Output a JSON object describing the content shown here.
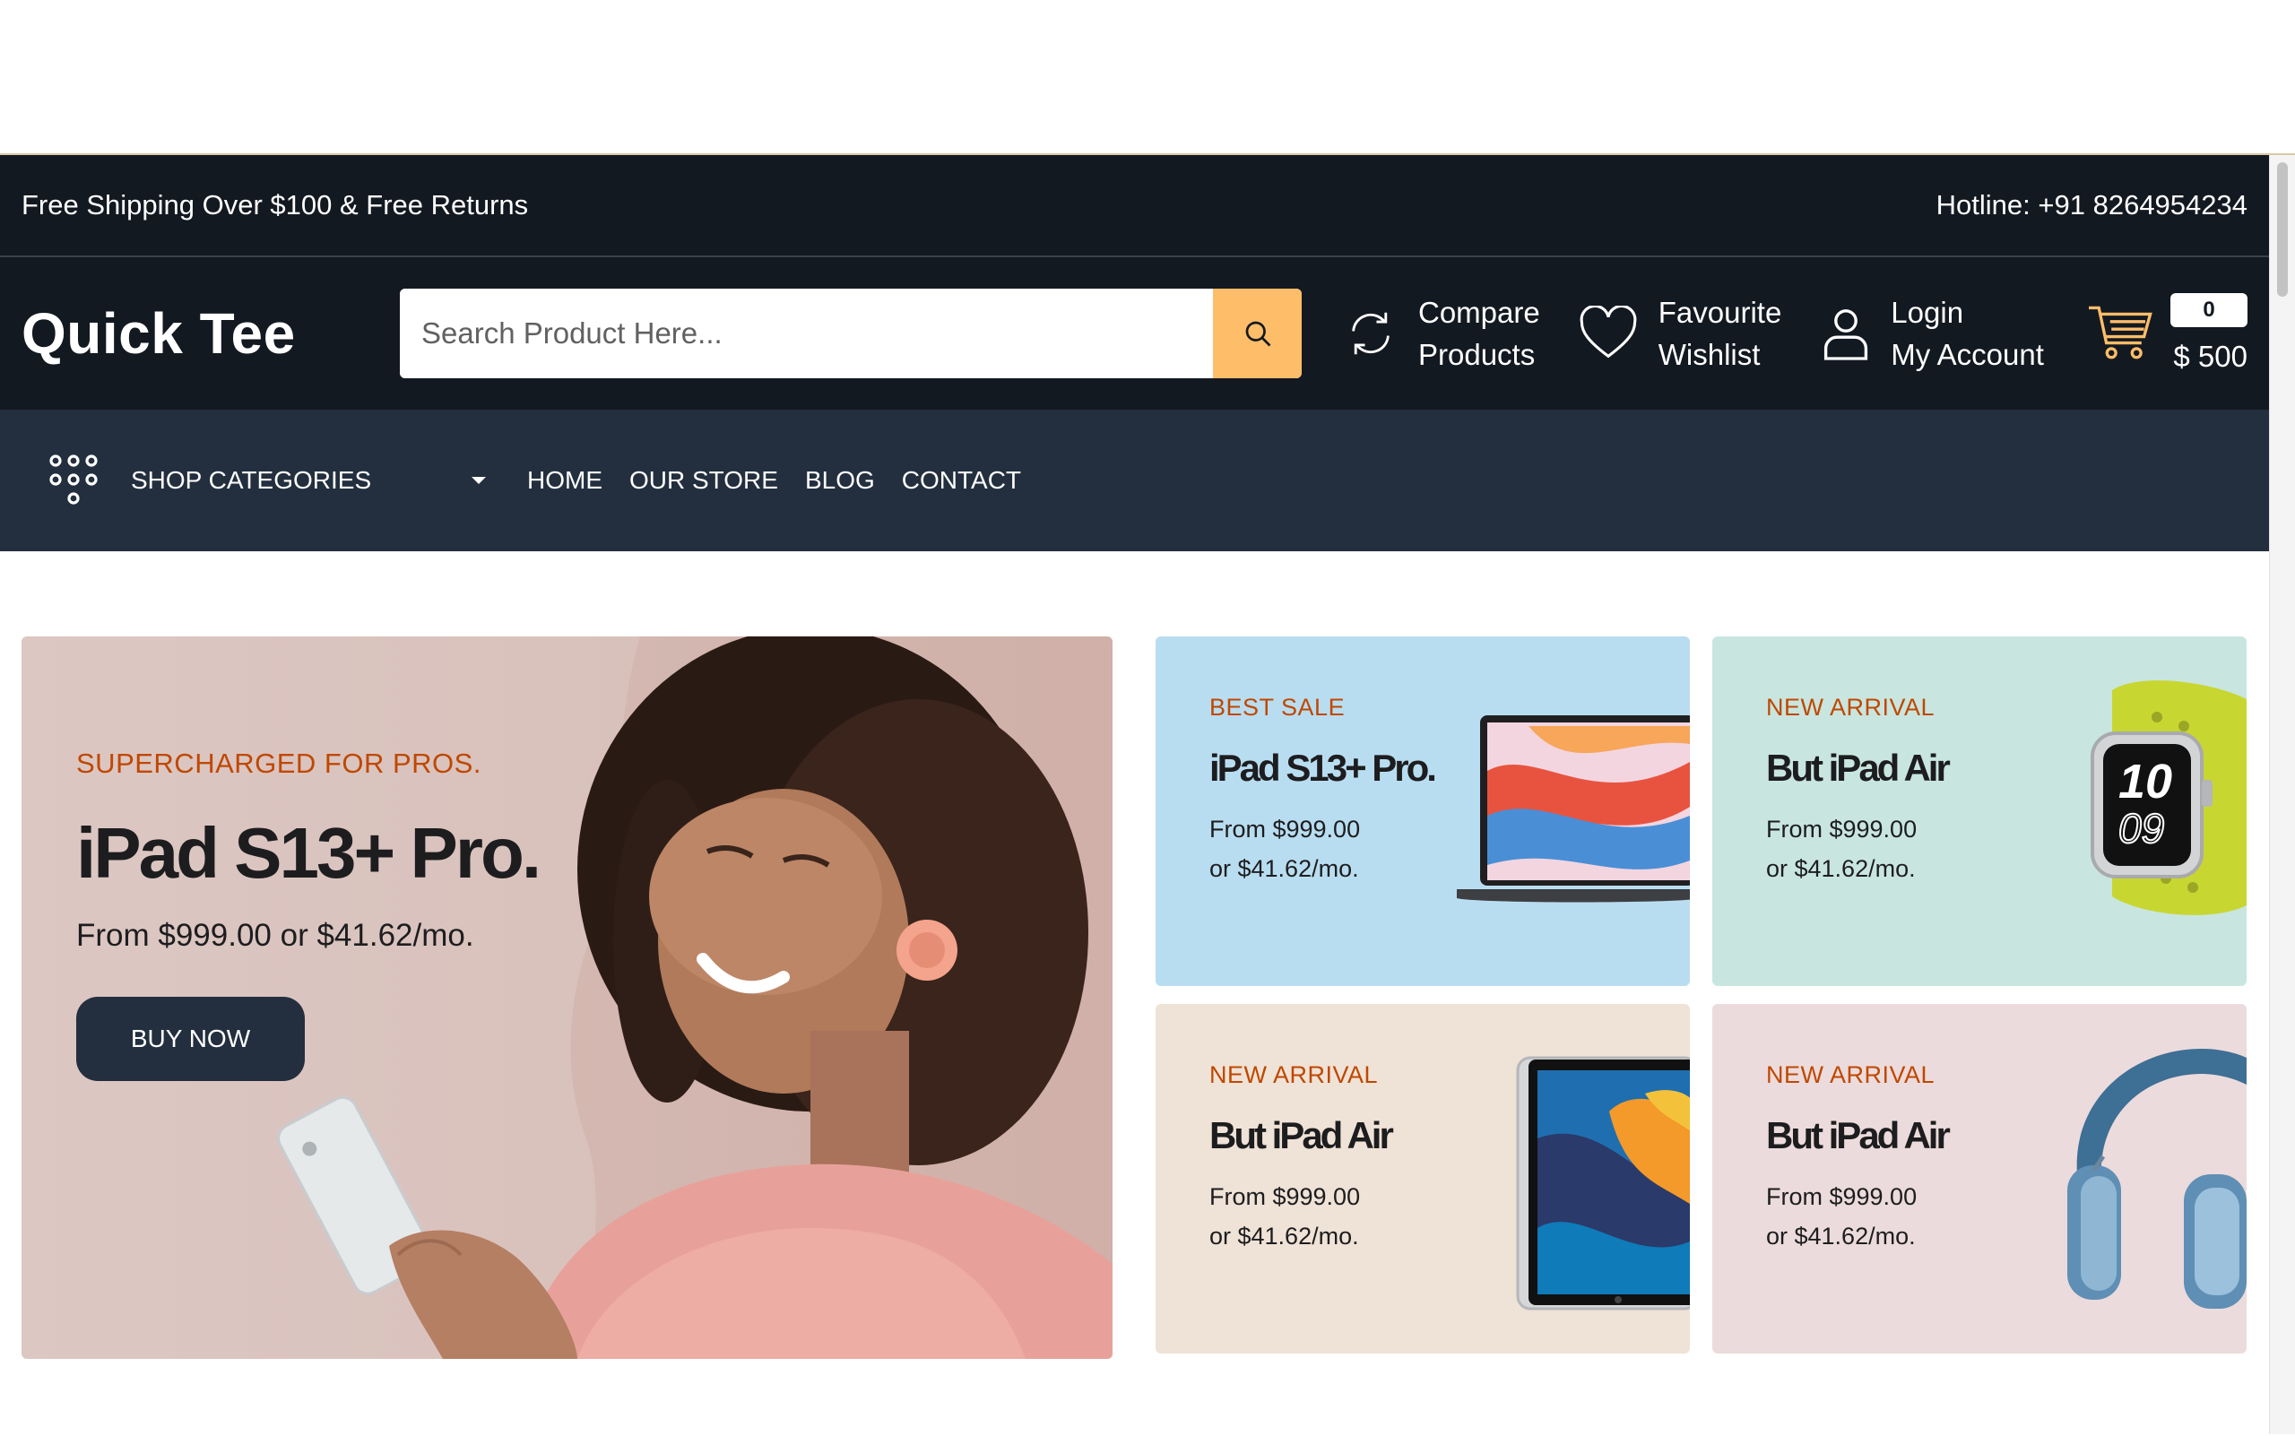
{
  "topbar": {
    "shipping": "Free Shipping Over $100 & Free Returns",
    "hotline": "Hotline: +91 8264954234"
  },
  "header": {
    "logo": "Quick Tee",
    "search_placeholder": "Search Product Here...",
    "compare": [
      "Compare",
      "Products"
    ],
    "wishlist": [
      "Favourite",
      "Wishlist"
    ],
    "account": [
      "Login",
      "My Account"
    ],
    "cart_count": "0",
    "cart_total": "$ 500"
  },
  "nav": {
    "categories_label": "SHOP CATEGORIES",
    "links": [
      "HOME",
      "OUR STORE",
      "BLOG",
      "CONTACT"
    ]
  },
  "hero": {
    "eyebrow": "SUPERCHARGED FOR PROS.",
    "title": "iPad S13+ Pro.",
    "price": "From $999.00 or $41.62/mo.",
    "button": "BUY NOW"
  },
  "cards": [
    {
      "eyebrow": "BEST SALE",
      "title": "iPad S13+ Pro.",
      "price1": "From $999.00",
      "price2": "or $41.62/mo.",
      "bg": "#b9ddf0",
      "product_icon": "laptop-icon"
    },
    {
      "eyebrow": "NEW ARRIVAL",
      "title": "But iPad Air",
      "price1": "From $999.00",
      "price2": "or $41.62/mo.",
      "bg": "#c8e6df",
      "product_icon": "smartwatch-icon"
    },
    {
      "eyebrow": "NEW ARRIVAL",
      "title": "But iPad Air",
      "price1": "From $999.00",
      "price2": "or $41.62/mo.",
      "bg": "#efe2d6",
      "product_icon": "tablet-icon"
    },
    {
      "eyebrow": "NEW ARRIVAL",
      "title": "But iPad Air",
      "price1": "From $999.00",
      "price2": "or $41.62/mo.",
      "bg": "#ecdbdc",
      "product_icon": "headphones-icon"
    }
  ],
  "colors": {
    "header_bg": "#131921",
    "nav_bg": "#232f3e",
    "accent": "#febd69",
    "eyebrow": "#bf4800"
  }
}
